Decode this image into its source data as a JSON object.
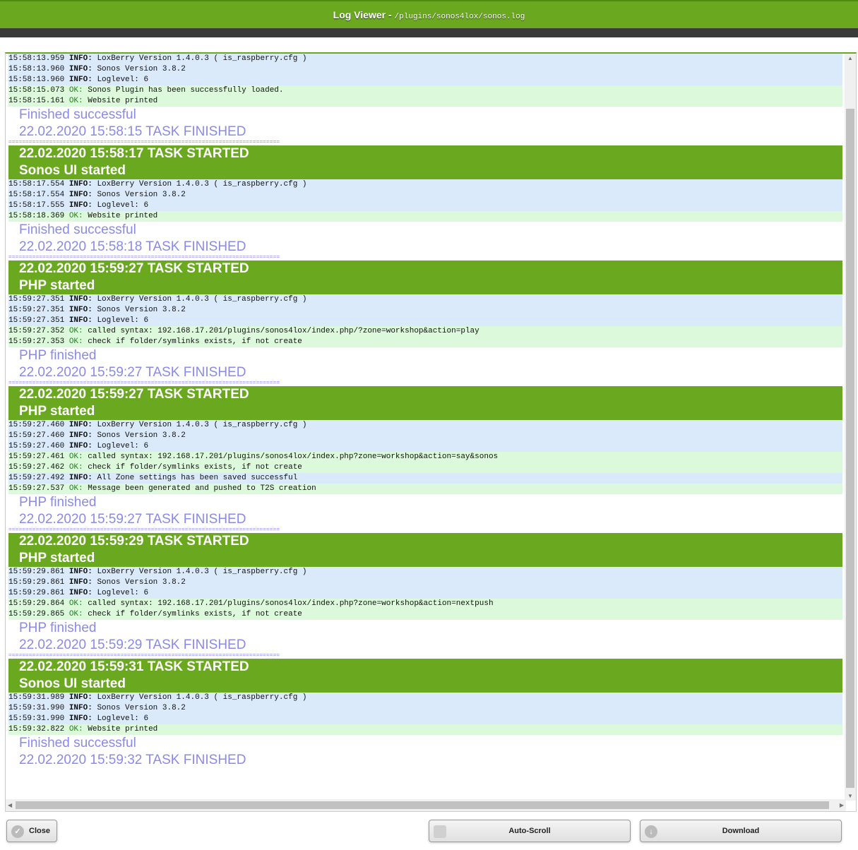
{
  "header": {
    "title": "Log Viewer - ",
    "path": "/plugins/sonos4lox/sonos.log"
  },
  "log": [
    {
      "t": "line",
      "lvl": "info",
      "time": "15:58:13.959",
      "level": "INFO:",
      "msg": "LoxBerry Version 1.4.0.3 ( is_raspberry.cfg )"
    },
    {
      "t": "line",
      "lvl": "info",
      "time": "15:58:13.960",
      "level": "INFO:",
      "msg": "Sonos Version 3.8.2"
    },
    {
      "t": "line",
      "lvl": "info",
      "time": "15:58:13.960",
      "level": "INFO:",
      "msg": "Loglevel: 6"
    },
    {
      "t": "line",
      "lvl": "ok",
      "time": "15:58:15.073",
      "level": "OK:",
      "msg": "Sonos Plugin has been successfully loaded."
    },
    {
      "t": "line",
      "lvl": "ok",
      "time": "15:58:15.161",
      "level": "OK:",
      "msg": "Website printed"
    },
    {
      "t": "fin",
      "text": "Finished successful"
    },
    {
      "t": "fin",
      "text": "22.02.2020 15:58:15 TASK FINISHED"
    },
    {
      "t": "sep",
      "text": "================================================================================"
    },
    {
      "t": "task",
      "l1": "22.02.2020 15:58:17 TASK STARTED",
      "l2": "Sonos UI started"
    },
    {
      "t": "line",
      "lvl": "info",
      "time": "15:58:17.554",
      "level": "INFO:",
      "msg": "LoxBerry Version 1.4.0.3 ( is_raspberry.cfg )"
    },
    {
      "t": "line",
      "lvl": "info",
      "time": "15:58:17.554",
      "level": "INFO:",
      "msg": "Sonos Version 3.8.2"
    },
    {
      "t": "line",
      "lvl": "info",
      "time": "15:58:17.555",
      "level": "INFO:",
      "msg": "Loglevel: 6"
    },
    {
      "t": "line",
      "lvl": "ok",
      "time": "15:58:18.369",
      "level": "OK:",
      "msg": "Website printed"
    },
    {
      "t": "fin",
      "text": "Finished successful"
    },
    {
      "t": "fin",
      "text": "22.02.2020 15:58:18 TASK FINISHED"
    },
    {
      "t": "sep",
      "text": "================================================================================"
    },
    {
      "t": "task",
      "l1": "22.02.2020 15:59:27 TASK STARTED",
      "l2": "PHP started"
    },
    {
      "t": "line",
      "lvl": "info",
      "time": "15:59:27.351",
      "level": "INFO:",
      "msg": "LoxBerry Version 1.4.0.3 ( is_raspberry.cfg )"
    },
    {
      "t": "line",
      "lvl": "info",
      "time": "15:59:27.351",
      "level": "INFO:",
      "msg": "Sonos Version 3.8.2"
    },
    {
      "t": "line",
      "lvl": "info",
      "time": "15:59:27.351",
      "level": "INFO:",
      "msg": "Loglevel: 6"
    },
    {
      "t": "line",
      "lvl": "ok",
      "time": "15:59:27.352",
      "level": "OK:",
      "msg": "called syntax: 192.168.17.201/plugins/sonos4lox/index.php/?zone=workshop&action=play"
    },
    {
      "t": "line",
      "lvl": "ok",
      "time": "15:59:27.353",
      "level": "OK:",
      "msg": "check if folder/symlinks exists, if not create"
    },
    {
      "t": "fin",
      "text": "PHP finished"
    },
    {
      "t": "fin",
      "text": "22.02.2020 15:59:27 TASK FINISHED"
    },
    {
      "t": "sep",
      "text": "================================================================================"
    },
    {
      "t": "task",
      "l1": "22.02.2020 15:59:27 TASK STARTED",
      "l2": "PHP started"
    },
    {
      "t": "line",
      "lvl": "info",
      "time": "15:59:27.460",
      "level": "INFO:",
      "msg": "LoxBerry Version 1.4.0.3 ( is_raspberry.cfg )"
    },
    {
      "t": "line",
      "lvl": "info",
      "time": "15:59:27.460",
      "level": "INFO:",
      "msg": "Sonos Version 3.8.2"
    },
    {
      "t": "line",
      "lvl": "info",
      "time": "15:59:27.460",
      "level": "INFO:",
      "msg": "Loglevel: 6"
    },
    {
      "t": "line",
      "lvl": "ok",
      "time": "15:59:27.461",
      "level": "OK:",
      "msg": "called syntax: 192.168.17.201/plugins/sonos4lox/index.php?zone=workshop&action=say&sonos"
    },
    {
      "t": "line",
      "lvl": "ok",
      "time": "15:59:27.462",
      "level": "OK:",
      "msg": "check if folder/symlinks exists, if not create"
    },
    {
      "t": "line",
      "lvl": "info",
      "time": "15:59:27.492",
      "level": "INFO:",
      "msg": "All Zone settings has been saved successful"
    },
    {
      "t": "line",
      "lvl": "ok",
      "time": "15:59:27.537",
      "level": "OK:",
      "msg": "Message been generated and pushed to T2S creation"
    },
    {
      "t": "fin",
      "text": "PHP finished"
    },
    {
      "t": "fin",
      "text": "22.02.2020 15:59:27 TASK FINISHED"
    },
    {
      "t": "sep",
      "text": "================================================================================"
    },
    {
      "t": "task",
      "l1": "22.02.2020 15:59:29 TASK STARTED",
      "l2": "PHP started"
    },
    {
      "t": "line",
      "lvl": "info",
      "time": "15:59:29.861",
      "level": "INFO:",
      "msg": "LoxBerry Version 1.4.0.3 ( is_raspberry.cfg )"
    },
    {
      "t": "line",
      "lvl": "info",
      "time": "15:59:29.861",
      "level": "INFO:",
      "msg": "Sonos Version 3.8.2"
    },
    {
      "t": "line",
      "lvl": "info",
      "time": "15:59:29.861",
      "level": "INFO:",
      "msg": "Loglevel: 6"
    },
    {
      "t": "line",
      "lvl": "ok",
      "time": "15:59:29.864",
      "level": "OK:",
      "msg": "called syntax: 192.168.17.201/plugins/sonos4lox/index.php?zone=workshop&action=nextpush"
    },
    {
      "t": "line",
      "lvl": "ok",
      "time": "15:59:29.865",
      "level": "OK:",
      "msg": "check if folder/symlinks exists, if not create"
    },
    {
      "t": "fin",
      "text": "PHP finished"
    },
    {
      "t": "fin",
      "text": "22.02.2020 15:59:29 TASK FINISHED"
    },
    {
      "t": "sep",
      "text": "================================================================================"
    },
    {
      "t": "task",
      "l1": "22.02.2020 15:59:31 TASK STARTED",
      "l2": "Sonos UI started"
    },
    {
      "t": "line",
      "lvl": "info",
      "time": "15:59:31.989",
      "level": "INFO:",
      "msg": "LoxBerry Version 1.4.0.3 ( is_raspberry.cfg )"
    },
    {
      "t": "line",
      "lvl": "info",
      "time": "15:59:31.990",
      "level": "INFO:",
      "msg": "Sonos Version 3.8.2"
    },
    {
      "t": "line",
      "lvl": "info",
      "time": "15:59:31.990",
      "level": "INFO:",
      "msg": "Loglevel: 6"
    },
    {
      "t": "line",
      "lvl": "ok",
      "time": "15:59:32.822",
      "level": "OK:",
      "msg": "Website printed"
    },
    {
      "t": "fin",
      "text": "Finished successful"
    },
    {
      "t": "fin",
      "text": "22.02.2020 15:59:32 TASK FINISHED"
    }
  ],
  "buttons": {
    "close": "Close",
    "autoscroll": "Auto-Scroll",
    "download": "Download"
  }
}
